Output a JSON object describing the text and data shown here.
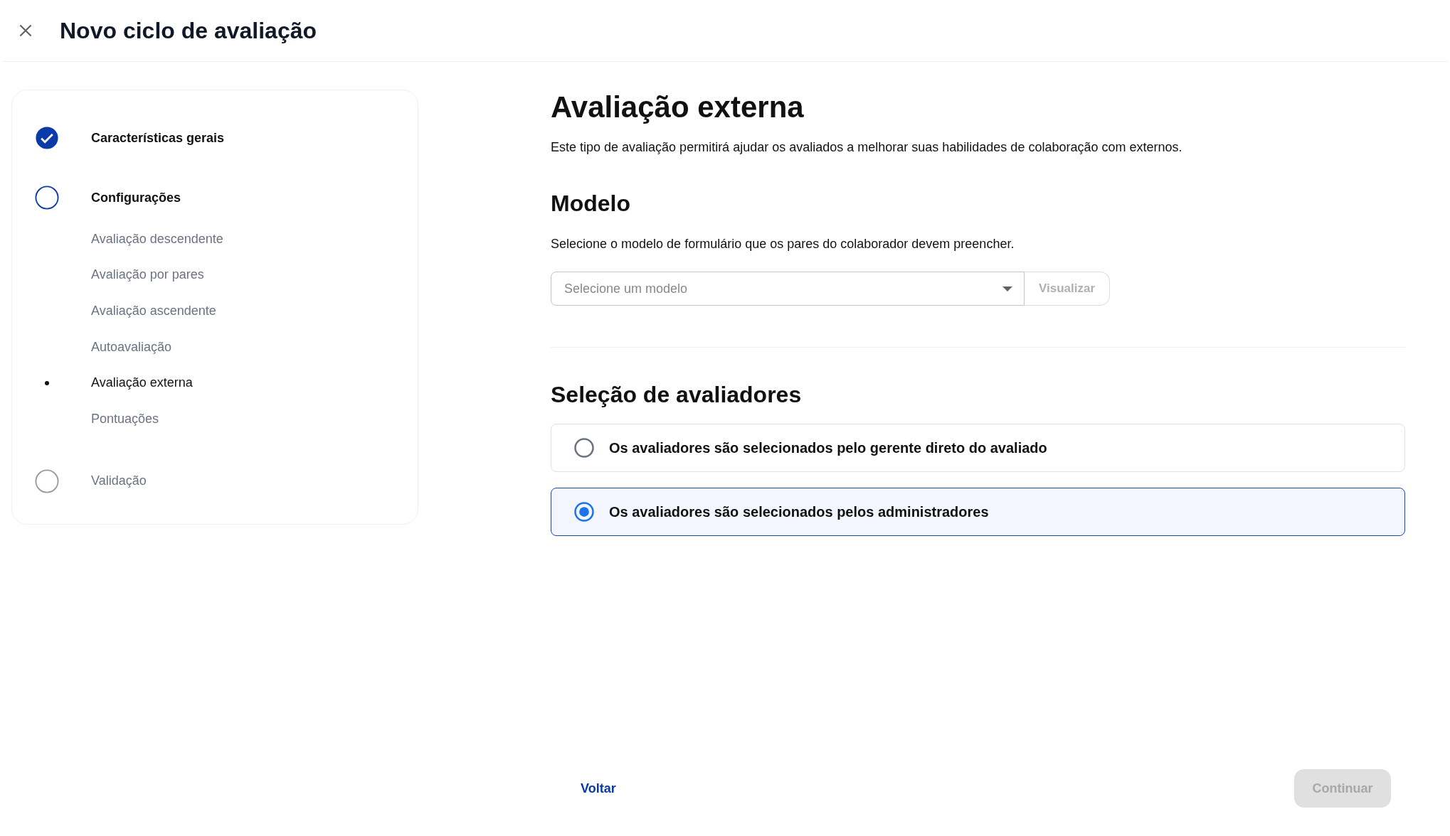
{
  "header": {
    "title": "Novo ciclo de avaliação"
  },
  "steps": [
    {
      "label": "Características gerais",
      "completed": true,
      "active": false
    },
    {
      "label": "Configurações",
      "completed": false,
      "active": true,
      "children": [
        {
          "label": "Avaliação descendente",
          "selected": false
        },
        {
          "label": "Avaliação por pares",
          "selected": false
        },
        {
          "label": "Avaliação ascendente",
          "selected": false
        },
        {
          "label": "Autoavaliação",
          "selected": false
        },
        {
          "label": "Avaliação externa",
          "selected": true
        },
        {
          "label": "Pontuações",
          "selected": false
        }
      ]
    },
    {
      "label": "Validação",
      "completed": false,
      "active": false
    }
  ],
  "main": {
    "title": "Avaliação externa",
    "description": "Este tipo de avaliação permitirá ajudar os avaliados a melhorar suas habilidades de colaboração com externos.",
    "model": {
      "heading": "Modelo",
      "description": "Selecione o modelo de formulário que os pares do colaborador devem preencher.",
      "placeholder": "Selecione um modelo",
      "preview_button": {
        "label": "Visualizar",
        "disabled": true
      }
    },
    "evaluators": {
      "heading": "Seleção de avaliadores",
      "options": [
        {
          "label": "Os avaliadores são selecionados pelo gerente direto do avaliado",
          "selected": false
        },
        {
          "label": "Os avaliadores são selecionados pelos administradores",
          "selected": true
        }
      ]
    }
  },
  "footer": {
    "back": "Voltar",
    "continue": {
      "label": "Continuar",
      "disabled": true
    }
  }
}
